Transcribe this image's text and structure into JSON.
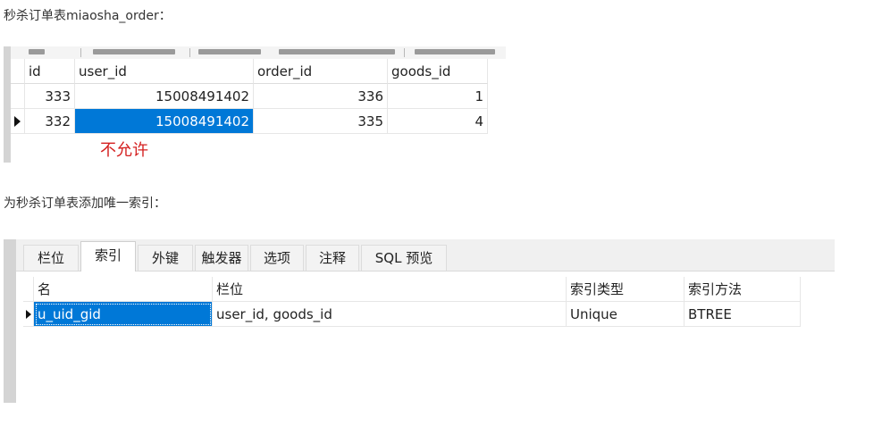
{
  "paragraph1": "秒杀订单表miaosha_order：",
  "paragraph2": "为秒杀订单表添加唯一索引：",
  "orders_table": {
    "columns": [
      "id",
      "user_id",
      "order_id",
      "goods_id"
    ],
    "rows": [
      {
        "id": "333",
        "user_id": "15008491402",
        "order_id": "336",
        "goods_id": "1"
      },
      {
        "id": "332",
        "user_id": "15008491402",
        "order_id": "335",
        "goods_id": "4"
      }
    ],
    "selected_row_index": 1,
    "selected_column": "user_id"
  },
  "annotation": "不允许",
  "index_designer": {
    "tabs": [
      "栏位",
      "索引",
      "外键",
      "触发器",
      "选项",
      "注释",
      "SQL 预览"
    ],
    "active_tab": "索引",
    "columns": [
      "名",
      "栏位",
      "索引类型",
      "索引方法"
    ],
    "rows": [
      {
        "name": "u_uid_gid",
        "fields": "user_id, goods_id",
        "type": "Unique",
        "method": "BTREE"
      }
    ]
  },
  "colors": {
    "selection": "#0078d7",
    "annotation": "#d42020"
  },
  "icons": {
    "current_row_marker": "row-indicator-icon"
  }
}
